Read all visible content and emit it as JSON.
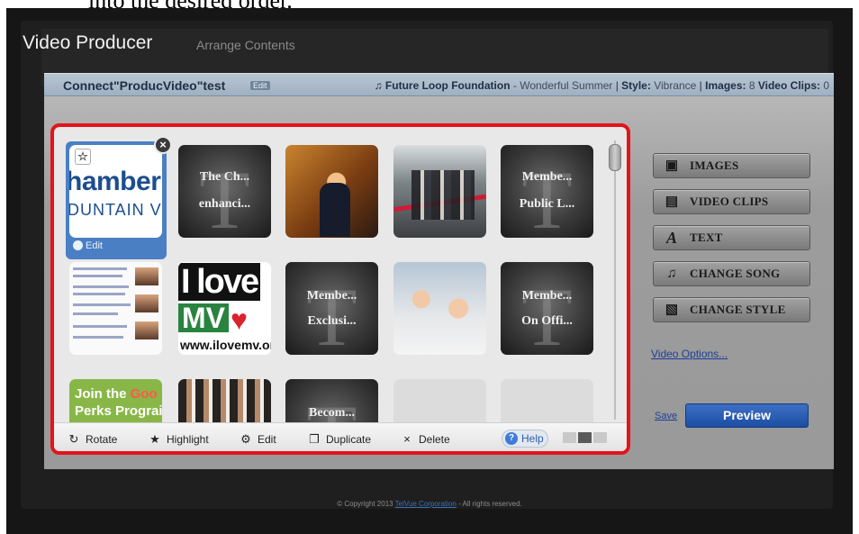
{
  "caption": "into the desired order.",
  "header": {
    "title": "Video Producer",
    "subtitle": "Arrange Contents"
  },
  "infobar": {
    "project_name": "Connect\"ProducVideo\"test",
    "edit_label": "Edit",
    "song_icon": "music-note-icon",
    "artist": "Future Loop Foundation",
    "dash": " - ",
    "song": "Wonderful Summer",
    "sep": " | ",
    "style_label": "Style:",
    "style_value": " Vibrance",
    "images_label": "Images:",
    "images_value": " 8",
    "clips_label": "Video Clips:",
    "clips_value": " 0"
  },
  "tiles": {
    "selected": {
      "line1": "hamber",
      "line2": "DUNTAIN V",
      "edit": "Edit"
    },
    "t2": {
      "line1": "The Ch...",
      "line2": "enhanci..."
    },
    "t5": {
      "line1": "Membe...",
      "line2": "Public L..."
    },
    "ilove": {
      "line1": "I love",
      "line2": "MV",
      "line3": "www.ilovemv.or"
    },
    "t8": {
      "line1": "Membe...",
      "line2": "Exclusi..."
    },
    "t10": {
      "line1": "Membe...",
      "line2": "On Offi..."
    },
    "google": {
      "line1a": "Join the ",
      "line1b": "Goo",
      "line2": "Perks Prograi"
    },
    "t13": {
      "line1": "Becom..."
    }
  },
  "toolbar": {
    "rotate": "Rotate",
    "highlight": "Highlight",
    "edit": "Edit",
    "duplicate": "Duplicate",
    "delete": "Delete",
    "help": "Help"
  },
  "sidebar": {
    "images": "IMAGES",
    "video_clips": "VIDEO CLIPS",
    "text": "TEXT",
    "change_song": "CHANGE SONG",
    "change_style": "CHANGE STYLE",
    "video_options": "Video Options..."
  },
  "actions": {
    "save": "Save",
    "preview": "Preview"
  },
  "footer": {
    "prefix": "© Copyright 2013 ",
    "company": "TelVue Corporation",
    "suffix": " - All rights reserved."
  },
  "colors": {
    "highlight_border": "#e3141b",
    "accent_blue": "#1c4ea4",
    "selected_tile": "#4a7fc4"
  }
}
